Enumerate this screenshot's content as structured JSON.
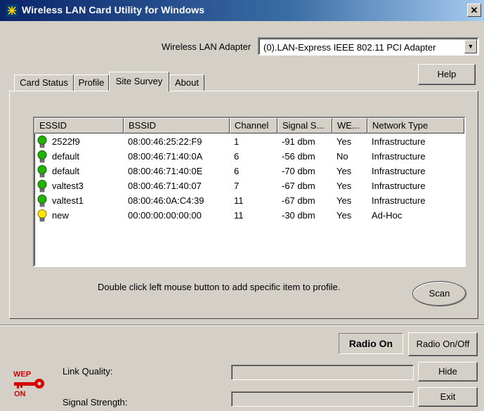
{
  "window": {
    "title": "Wireless LAN Card Utility for Windows",
    "close_label": "✕"
  },
  "adapter": {
    "label": "Wireless LAN Adapter",
    "value": "(0).LAN-Express IEEE 802.11 PCI Adapter"
  },
  "buttons": {
    "help": "Help",
    "scan": "Scan",
    "radio_toggle": "Radio On/Off",
    "hide": "Hide",
    "exit": "Exit"
  },
  "tabs": [
    {
      "label": "Card Status"
    },
    {
      "label": "Profile"
    },
    {
      "label": "Site Survey"
    },
    {
      "label": "About"
    }
  ],
  "active_tab": "Site Survey",
  "survey": {
    "columns": [
      "ESSID",
      "BSSID",
      "Channel",
      "Signal S...",
      "WE...",
      "Network Type"
    ],
    "rows": [
      {
        "essid": "2522f9",
        "bssid": "08:00:46:25:22:F9",
        "channel": "1",
        "signal": "-91 dbm",
        "wep": "Yes",
        "type": "Infrastructure",
        "bulb": "green"
      },
      {
        "essid": "default",
        "bssid": "08:00:46:71:40:0A",
        "channel": "6",
        "signal": "-56 dbm",
        "wep": "No",
        "type": "Infrastructure",
        "bulb": "green"
      },
      {
        "essid": "default",
        "bssid": "08:00:46:71:40:0E",
        "channel": "6",
        "signal": "-70 dbm",
        "wep": "Yes",
        "type": "Infrastructure",
        "bulb": "green"
      },
      {
        "essid": "valtest3",
        "bssid": "08:00:46:71:40:07",
        "channel": "7",
        "signal": "-67 dbm",
        "wep": "Yes",
        "type": "Infrastructure",
        "bulb": "green"
      },
      {
        "essid": "valtest1",
        "bssid": "08:00:46:0A:C4:39",
        "channel": "11",
        "signal": "-67 dbm",
        "wep": "Yes",
        "type": "Infrastructure",
        "bulb": "green"
      },
      {
        "essid": "new",
        "bssid": "00:00:00:00:00:00",
        "channel": "11",
        "signal": "-30 dbm",
        "wep": "Yes",
        "type": "Ad-Hoc",
        "bulb": "yellow"
      }
    ],
    "hint": "Double click left mouse button to add specific item to profile."
  },
  "status": {
    "radio": "Radio On",
    "link_quality_label": "Link Quality:",
    "signal_strength_label": "Signal Strength:",
    "wep_badge_top": "WEP",
    "wep_badge_bottom": "ON"
  },
  "colors": {
    "bulb_green": "#22b300",
    "bulb_yellow": "#ffe600",
    "wep_red": "#d40000"
  }
}
